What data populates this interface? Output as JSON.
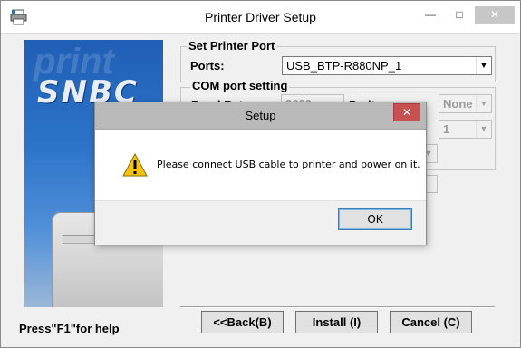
{
  "window": {
    "title": "Printer Driver Setup",
    "minimize_glyph": "—",
    "maximize_glyph": "□",
    "close_glyph": "✕"
  },
  "banner": {
    "logo_text": "SNBC",
    "ghost_text": "print"
  },
  "printer_port": {
    "group_label": "Set Printer Port",
    "ports_label": "Ports:",
    "ports_value": "USB_BTP-R880NP_1"
  },
  "com_port": {
    "group_label": "COM port setting",
    "baud_label": "Baud Rate:",
    "baud_value": "9600",
    "parity_label": "Parity:",
    "parity_value": "None",
    "stop_bits_value": "1"
  },
  "footer": {
    "help_text": "Press\"F1\"for help",
    "back_label": "<<Back(B)",
    "install_label": "Install (I)",
    "cancel_label": "Cancel (C)"
  },
  "dialog": {
    "title": "Setup",
    "close_glyph": "✕",
    "message": "Please connect USB cable to printer and power on it.",
    "ok_label": "OK"
  },
  "colors": {
    "accent": "#3c7fb1",
    "close_red": "#c75050",
    "warning_yellow": "#f5c211"
  }
}
